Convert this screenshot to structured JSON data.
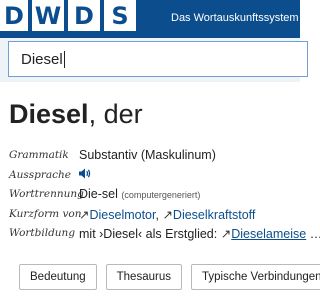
{
  "header": {
    "logo_letters": [
      "D",
      "W",
      "D",
      "S"
    ],
    "tagline": "Das Wortauskunftssystem zur"
  },
  "search": {
    "value": "Diesel"
  },
  "entry": {
    "lemma": "Diesel",
    "article": ", der",
    "rows": {
      "grammatik": {
        "label": "Grammatik",
        "value": "Substantiv (Maskulinum)"
      },
      "aussprache": {
        "label": "Aussprache",
        "icon": "speaker-icon"
      },
      "worttrennung": {
        "label": "Worttrennung",
        "value": "Die-sel",
        "note": "(computergeneriert)"
      },
      "kurzform": {
        "label": "Kurzform von",
        "link1": "Dieselmotor",
        "separator": ", ",
        "link2": "Dieselkraftstoff"
      },
      "wortbildung": {
        "label": "Wortbildung",
        "text": "mit ›Diesel‹ als Erstglied: ",
        "link": "Dieselameise",
        "more": " …"
      }
    }
  },
  "buttons": {
    "bedeutung": "Bedeutung",
    "thesaurus": "Thesaurus",
    "verbindungen": "Typische Verbindungen"
  },
  "colors": {
    "brand": "#0c4e8d",
    "link": "#0c4e8d",
    "search_border": "#6f9fd3"
  }
}
